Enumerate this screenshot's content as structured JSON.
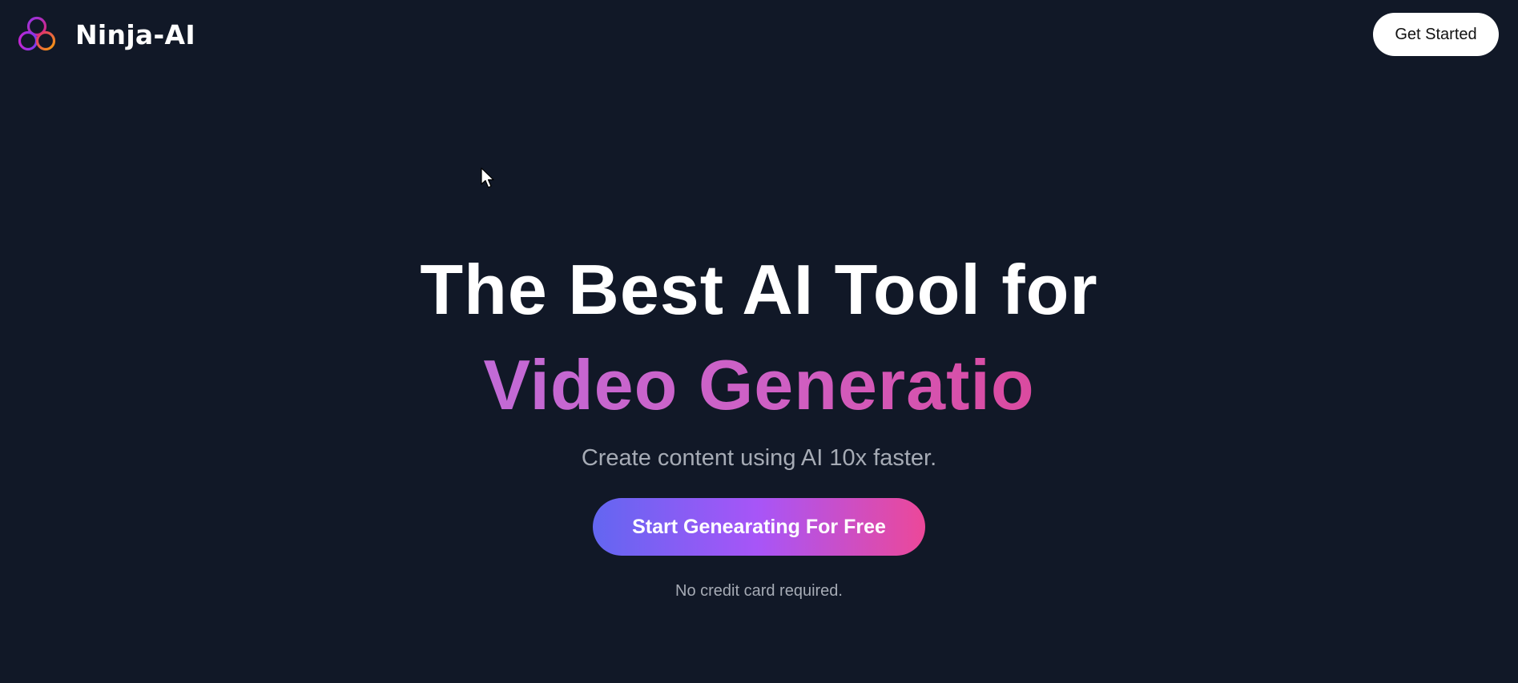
{
  "header": {
    "brand_name": "Ninja-AI",
    "logo_icon": "interlocking-rings-logo",
    "get_started_label": "Get Started"
  },
  "hero": {
    "headline_line1": "The Best AI Tool for",
    "headline_line2": "Video Generatio",
    "subtitle": "Create content using AI 10x faster.",
    "cta_label": "Start Genearating For Free",
    "note": "No credit card required."
  },
  "colors": {
    "background": "#111827",
    "headline_gradient": [
      "#c26ad6",
      "#cf5fc3",
      "#db4a9f"
    ],
    "cta_gradient": [
      "#6366f1",
      "#a855f7",
      "#ec4899"
    ],
    "muted_text": "#a6abb5",
    "logo_colors": [
      "#7c3aed",
      "#db2777",
      "#f59e0b"
    ]
  }
}
